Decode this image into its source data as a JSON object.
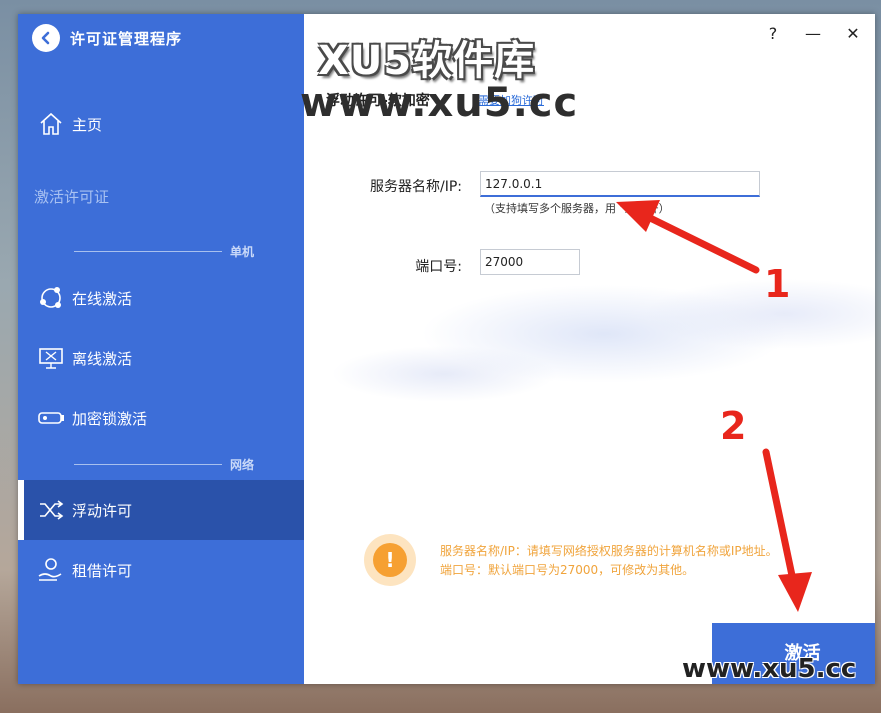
{
  "app": {
    "title": "许可证管理程序"
  },
  "sidebar": {
    "home": "主页",
    "section_activate": "激活许可证",
    "group_standalone": "单机",
    "online": "在线激活",
    "offline": "离线激活",
    "dongle": "加密锁激活",
    "group_network": "网络",
    "floating": "浮动许可",
    "borrow": "租借许可"
  },
  "window_controls": {
    "help": "?",
    "minimize": "—",
    "close": "✕"
  },
  "page": {
    "heading": "浮动许可-软加密",
    "link": "需要加狗许可"
  },
  "form": {
    "server_label": "服务器名称/IP:",
    "server_value": "127.0.0.1",
    "server_hint": "（支持填写多个服务器，用 \",\" 隔开）",
    "port_label": "端口号:",
    "port_value": "27000"
  },
  "notice": {
    "line1": "服务器名称/IP：请填写网络授权服务器的计算机名称或IP地址。",
    "line2": "端口号：默认端口号为27000，可修改为其他。"
  },
  "actions": {
    "activate": "激活"
  },
  "overlay": {
    "watermark_top": "XU5软件库",
    "watermark_url": "www.xu5.cc",
    "watermark_bottom": "www.xu5.cc",
    "step1": "1",
    "step2": "2"
  },
  "colors": {
    "sidebar": "#3d6ed8",
    "sidebar_active": "#2a52aa",
    "notice": "#f0a43c",
    "annotation": "#e8261c"
  }
}
